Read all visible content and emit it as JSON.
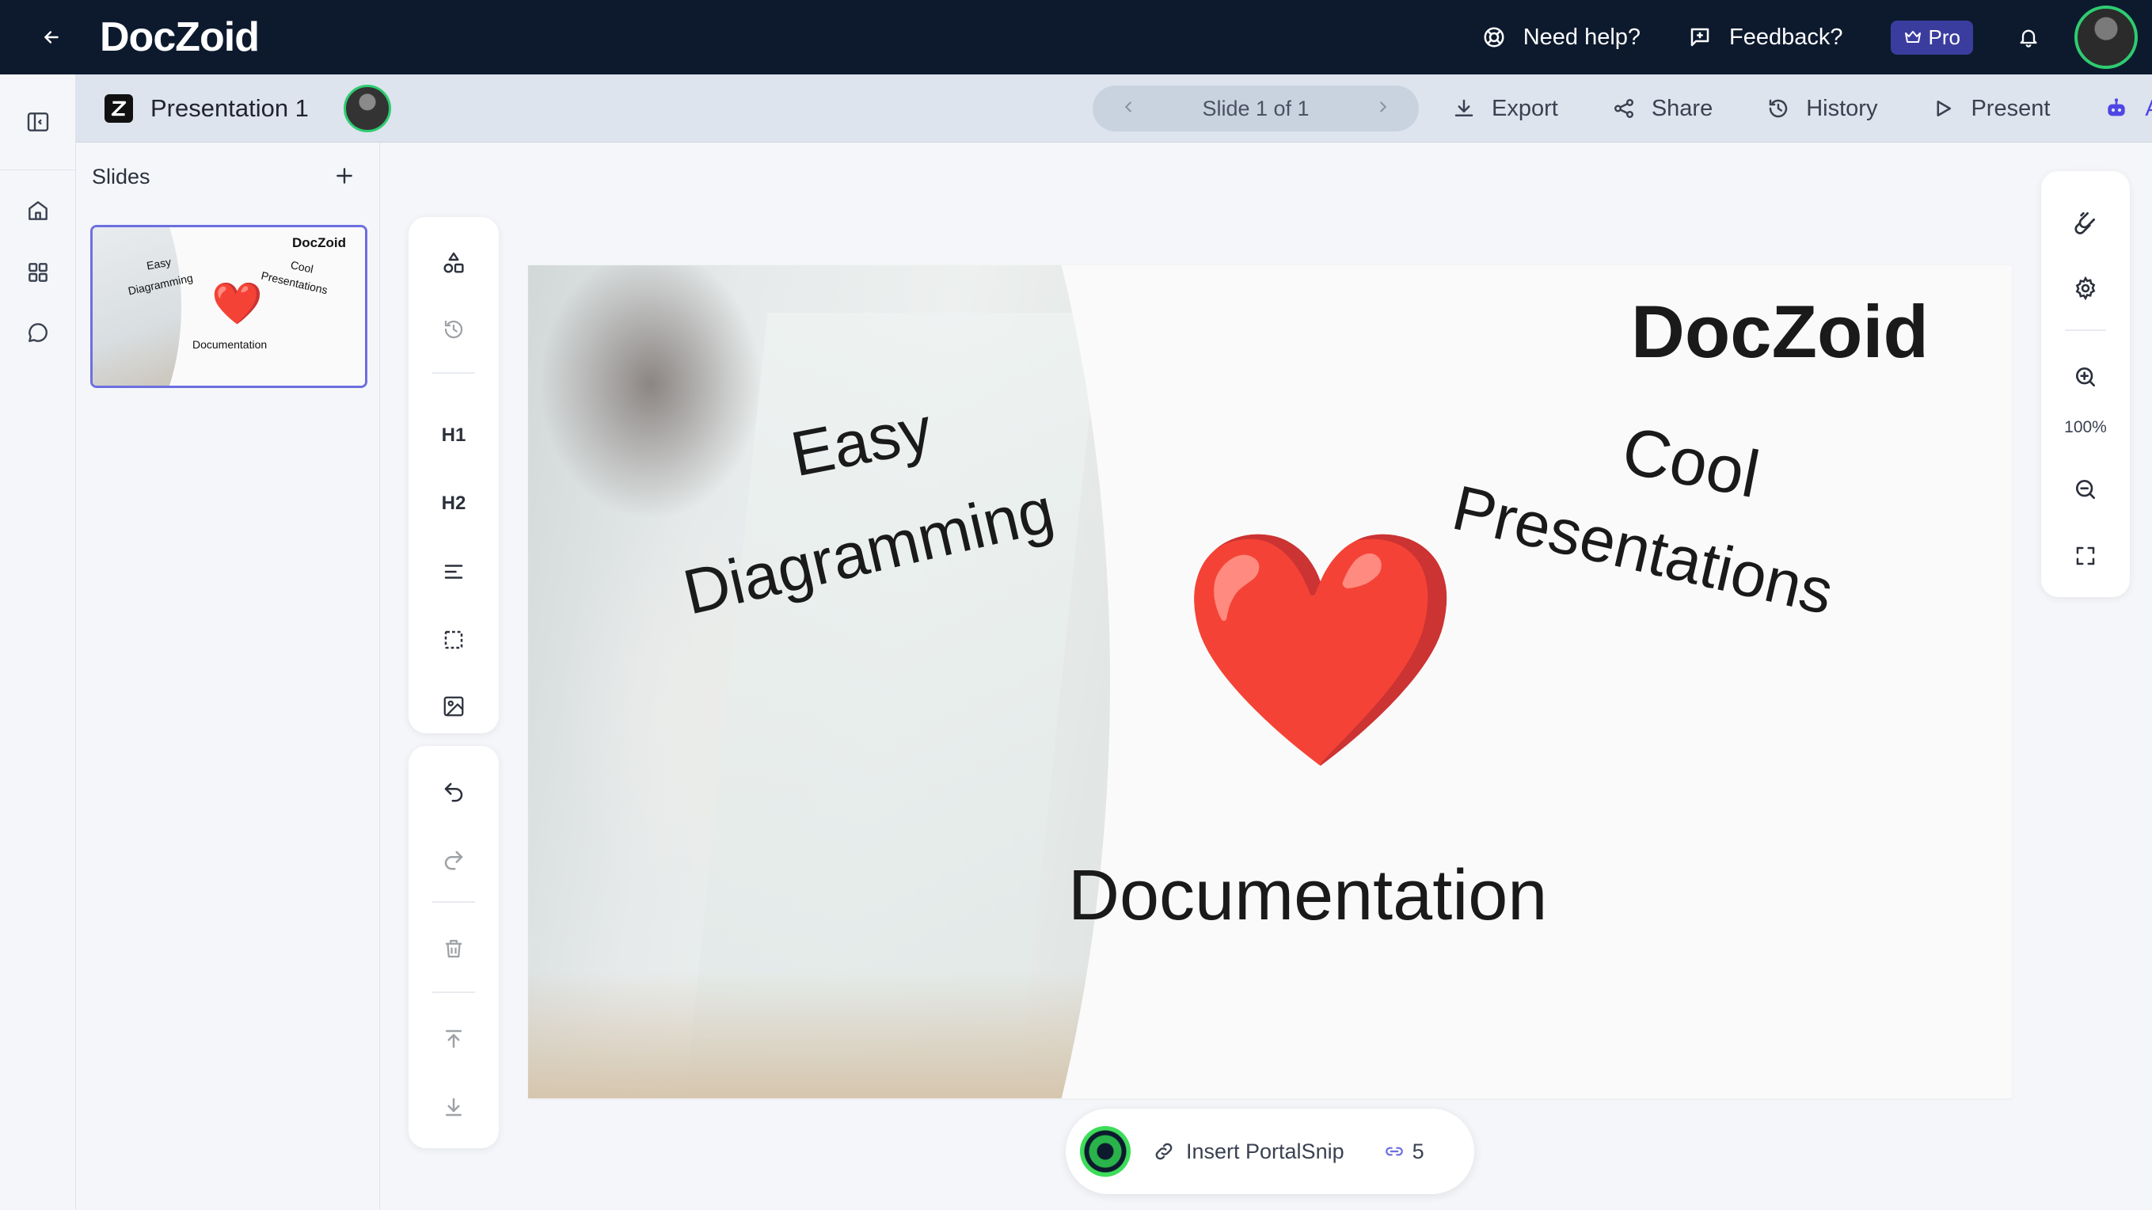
{
  "app": {
    "brand": "DocZoid"
  },
  "topbar": {
    "need_help": "Need help?",
    "feedback": "Feedback?",
    "pro": "Pro"
  },
  "subbar": {
    "document_title": "Presentation 1",
    "slide_indicator": "Slide 1 of 1",
    "export": "Export",
    "share": "Share",
    "history": "History",
    "present": "Present",
    "ai": "AI"
  },
  "slides_panel": {
    "header": "Slides",
    "thumbnail": {
      "title": "DocZoid",
      "easy": "Easy",
      "diagramming": "Diagramming",
      "cool": "Cool",
      "presentations": "Presentations",
      "documentation": "Documentation"
    }
  },
  "tools": {
    "h1": "H1",
    "h2": "H2"
  },
  "slide": {
    "title": "DocZoid",
    "easy": "Easy",
    "diagramming": "Diagramming",
    "cool": "Cool",
    "presentations": "Presentations",
    "heart": "❤️",
    "documentation": "Documentation"
  },
  "right_tools": {
    "zoom": "100%"
  },
  "bottom_bar": {
    "insert_label": "Insert PortalSnip",
    "link_count": "5"
  },
  "colors": {
    "navbar": "#0d1a2e",
    "accent": "#4f46e5",
    "pro_badge": "#3b3d9e",
    "avatar_ring": "#2ecc71"
  }
}
